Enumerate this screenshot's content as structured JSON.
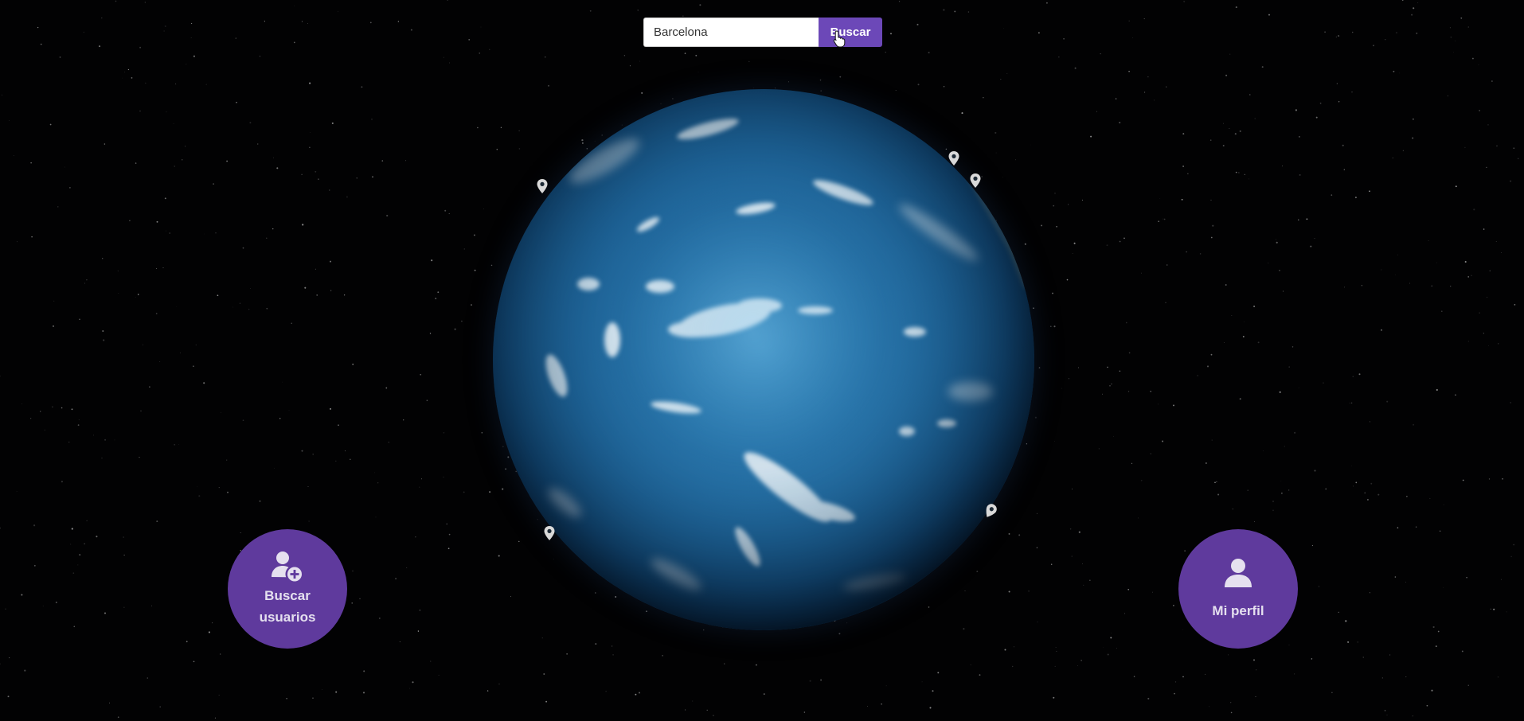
{
  "search": {
    "value": "Barcelona",
    "button_label": "Buscar"
  },
  "actions": {
    "find_users_label": "Buscar usuarios",
    "profile_label": "Mi perfil"
  },
  "icons": {
    "add_user": "user-plus-icon",
    "profile": "user-icon",
    "marker": "map-marker-icon",
    "cursor": "hand-pointer-icon"
  },
  "colors": {
    "accent": "#6c48b8",
    "round_button": "#5f3a9d",
    "ocean": "#1b5e92",
    "background": "#020203"
  }
}
